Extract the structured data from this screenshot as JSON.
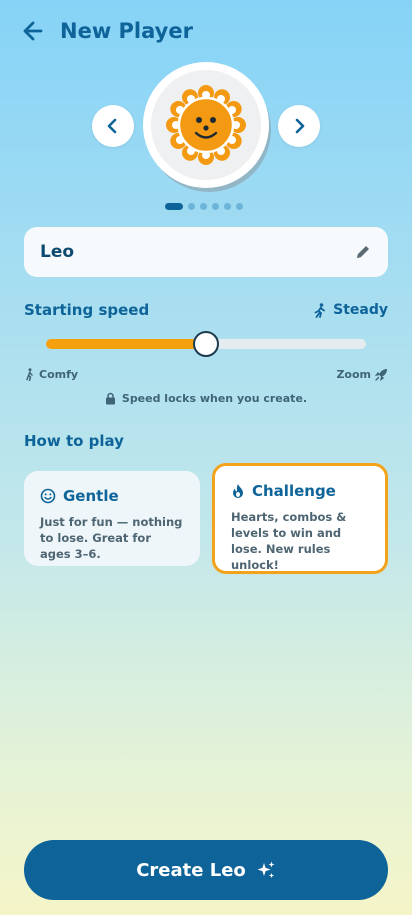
{
  "header": {
    "title": "New Player"
  },
  "avatar": {
    "selected_index": 0,
    "dot_count": 6
  },
  "name_field": {
    "value": "Leo"
  },
  "speed": {
    "label": "Starting speed",
    "current": "Steady",
    "min_label": "Comfy",
    "max_label": "Zoom",
    "level": 0.5,
    "lock_note": "Speed locks when you create."
  },
  "modes": {
    "label": "How to play",
    "gentle": {
      "title": "Gentle",
      "desc": "Just for fun — nothing to lose. Great for ages 3–6."
    },
    "challenge": {
      "title": "Challenge",
      "desc": "Hearts, combos & levels to win and lose. New rules unlock!",
      "selected": true
    }
  },
  "create_button": {
    "label": "Create Leo"
  },
  "colors": {
    "primary": "#0e6499",
    "accent": "#f5a10f",
    "sun": "#f49a12"
  }
}
